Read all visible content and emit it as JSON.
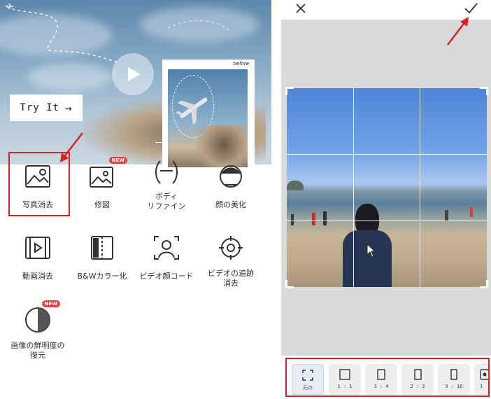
{
  "left": {
    "try_label": "Try It",
    "try_arrow": "→",
    "before_label": "before",
    "features": [
      {
        "label": "写真消去",
        "icon": "photo-remove-icon",
        "badge": ""
      },
      {
        "label": "修図",
        "icon": "image-edit-icon",
        "badge": "NEW"
      },
      {
        "label": "ボディ\nリファイン",
        "icon": "body-refine-icon",
        "badge": ""
      },
      {
        "label": "顔の美化",
        "icon": "face-beautify-icon",
        "badge": ""
      },
      {
        "label": "動画消去",
        "icon": "video-remove-icon",
        "badge": ""
      },
      {
        "label": "B&Wカラー化",
        "icon": "bw-colorize-icon",
        "badge": ""
      },
      {
        "label": "ビデオ顔コード",
        "icon": "video-face-icon",
        "badge": ""
      },
      {
        "label": "ビデオの追跡\n消去",
        "icon": "video-track-icon",
        "badge": ""
      },
      {
        "label": "画像の鮮明度の\n復元",
        "icon": "clarity-restore-icon",
        "badge": "NEW"
      }
    ]
  },
  "right": {
    "ratios": [
      {
        "label": "元の",
        "icon": "original-crop-icon",
        "selected": true
      },
      {
        "label": "1 : 1",
        "icon": "ratio-1-1-icon",
        "selected": false
      },
      {
        "label": "3 : 4",
        "icon": "ratio-3-4-icon",
        "selected": false
      },
      {
        "label": "2 : 3",
        "icon": "ratio-2-3-icon",
        "selected": false
      },
      {
        "label": "9 : 16",
        "icon": "ratio-9-16-icon",
        "selected": false
      },
      {
        "label": "1",
        "icon": "ratio-more-icon",
        "selected": false
      }
    ]
  },
  "colors": {
    "highlight": "#d42323",
    "new_badge": "#e0463f"
  }
}
